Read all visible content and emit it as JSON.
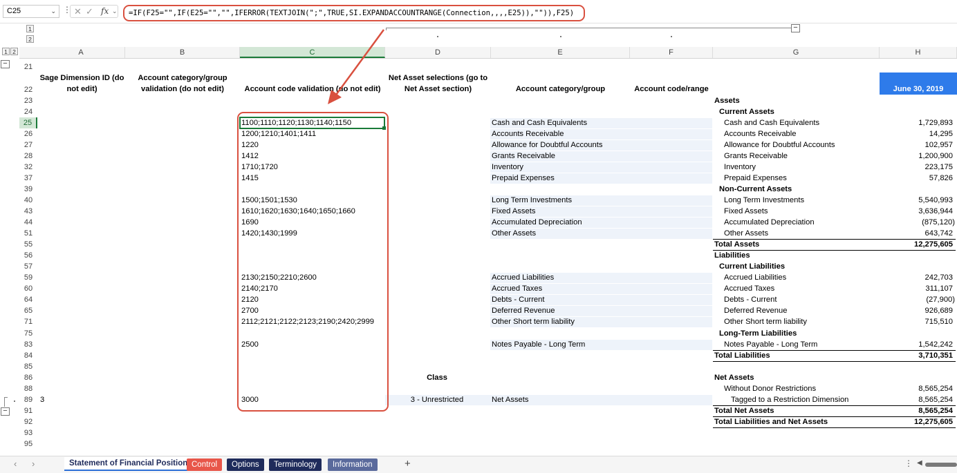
{
  "formula_bar": {
    "name_box": "C25",
    "fx_label": "fx",
    "formula": "=IF(F25=\"\",IF(E25=\"\",\"\",IFERROR(TEXTJOIN(\";\",TRUE,SI.EXPANDACCOUNTRANGE(Connection,,,,E25)),\"\")),F25)"
  },
  "outline": {
    "top_levels": [
      "1",
      "2"
    ],
    "left_levels": [
      "1",
      "2"
    ]
  },
  "columns": [
    "A",
    "B",
    "C",
    "D",
    "E",
    "F",
    "G",
    "H"
  ],
  "rows": [
    "21",
    "22",
    "23",
    "24",
    "25",
    "26",
    "27",
    "28",
    "32",
    "37",
    "39",
    "40",
    "43",
    "44",
    "51",
    "55",
    "56",
    "57",
    "59",
    "60",
    "64",
    "65",
    "71",
    "75",
    "83",
    "84",
    "85",
    "86",
    "88",
    "89",
    "91",
    "92",
    "93",
    "95"
  ],
  "headers": {
    "a": "Sage Dimension ID (do not edit)",
    "b": "Account category/group validation (do not edit)",
    "c": "Account code validation (do not edit)",
    "d": "Net Asset selections (go to Net Asset section)",
    "e": "Account category/group",
    "f": "Account code/range",
    "h": "June 30, 2019"
  },
  "column_c": [
    "1100;1110;1120;1130;1140;1150",
    "1200;1210;1401;1411",
    "1220",
    "1412",
    "1710;1720",
    "1415",
    "1500;1501;1530",
    "1610;1620;1630;1640;1650;1660",
    "1690",
    "1420;1430;1999",
    "2130;2150;2210;2600",
    "2140;2170",
    "2120",
    "2700",
    "2112;2121;2122;2123;2190;2420;2999",
    "2500",
    "3000"
  ],
  "column_e": [
    "Cash and Cash Equivalents",
    "Accounts Receivable",
    "Allowance for Doubtful Accounts",
    "Grants Receivable",
    "Inventory",
    "Prepaid Expenses",
    "Long Term Investments",
    "Fixed Assets",
    "Accumulated Depreciation",
    "Other Assets",
    "Accrued Liabilities",
    "Accrued Taxes",
    "Debts - Current",
    "Deferred Revenue",
    "Other Short term liability",
    "Notes Payable - Long Term",
    "Net Assets"
  ],
  "a89": "3",
  "d_class_label": "Class",
  "d89": "3 - Unrestricted",
  "statement": {
    "assets": "Assets",
    "current_assets": "Current Assets",
    "non_current_assets": "Non-Current Assets",
    "total_assets": "Total Assets",
    "total_assets_val": "12,275,605",
    "liabilities": "Liabilities",
    "current_liabilities": "Current Liabilities",
    "long_term_liabilities": "Long-Term Liabilities",
    "total_liabilities": "Total Liabilities",
    "total_liabilities_val": "3,710,351",
    "net_assets": "Net Assets",
    "without_donor": "Without Donor Restrictions",
    "without_donor_val": "8,565,254",
    "tagged": "Tagged to a Restriction Dimension",
    "tagged_val": "8,565,254",
    "total_net_assets": "Total Net Assets",
    "total_net_assets_val": "8,565,254",
    "total_liab_net": "Total Liabilities and Net Assets",
    "total_liab_net_val": "12,275,605",
    "values": [
      "1,729,893",
      "14,295",
      "102,957",
      "1,200,900",
      "223,175",
      "57,826",
      "5,540,993",
      "3,636,944",
      "(875,120)",
      "643,742",
      "242,703",
      "311,107",
      "(27,900)",
      "926,689",
      "715,510",
      "1,542,242"
    ]
  },
  "sheet_tabs": {
    "active": "Statement of Financial Position",
    "control": "Control",
    "options": "Options",
    "terminology": "Terminology",
    "information": "Information",
    "add": "+"
  },
  "colors": {
    "highlight_red": "#d9503f",
    "header_blue": "#2e7bea",
    "tab_control": "#e8564a",
    "tab_navy": "#1f2b5b",
    "tab_info": "#5a6a9c",
    "selection_green": "#1a7a38"
  }
}
